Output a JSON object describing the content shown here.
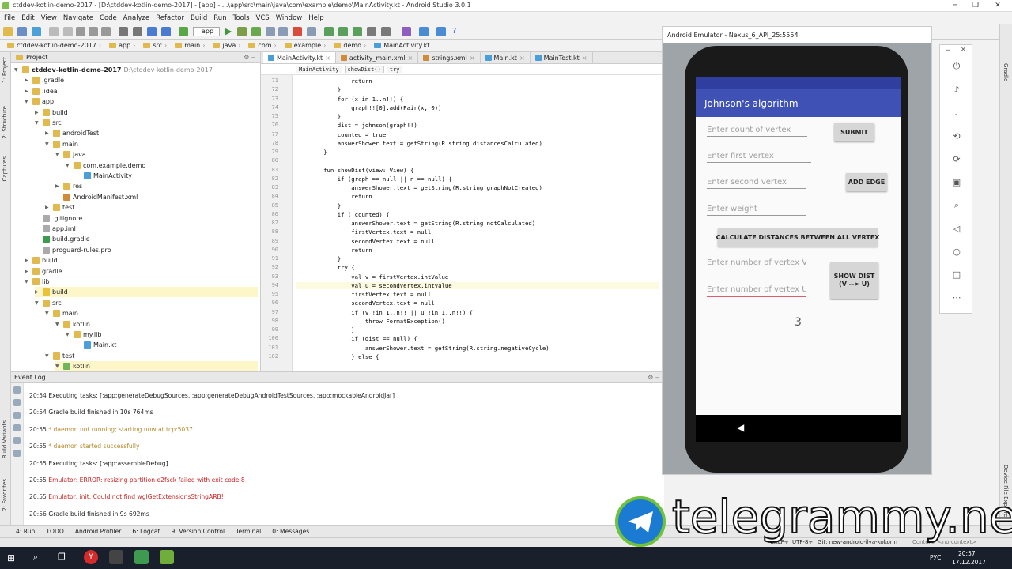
{
  "window": {
    "title": "ctddev-kotlin-demo-2017 - [D:\\ctddev-kotlin-demo-2017] - [app] - ...\\app\\src\\main\\java\\com\\example\\demo\\MainActivity.kt - Android Studio 3.0.1"
  },
  "menu": [
    "File",
    "Edit",
    "View",
    "Navigate",
    "Code",
    "Analyze",
    "Refactor",
    "Build",
    "Run",
    "Tools",
    "VCS",
    "Window",
    "Help"
  ],
  "toolbar": {
    "run_config": "app"
  },
  "breadcrumb": [
    "ctddev-kotlin-demo-2017",
    "app",
    "src",
    "main",
    "java",
    "com",
    "example",
    "demo",
    "MainActivity.kt"
  ],
  "project": {
    "header": "Project",
    "items": [
      {
        "label": "ctddev-kotlin-demo-2017",
        "extra": "D:\\ctddev-kotlin-demo-2017",
        "depth": 0,
        "open": true,
        "kind": "root"
      },
      {
        "label": ".gradle",
        "depth": 1,
        "open": false,
        "kind": "folder"
      },
      {
        "label": ".idea",
        "depth": 1,
        "open": false,
        "kind": "folder"
      },
      {
        "label": "app",
        "depth": 1,
        "open": true,
        "kind": "folder"
      },
      {
        "label": "build",
        "depth": 2,
        "open": false,
        "kind": "folder"
      },
      {
        "label": "src",
        "depth": 2,
        "open": true,
        "kind": "folder"
      },
      {
        "label": "androidTest",
        "depth": 3,
        "open": false,
        "kind": "folder"
      },
      {
        "label": "main",
        "depth": 3,
        "open": true,
        "kind": "folder"
      },
      {
        "label": "java",
        "depth": 4,
        "open": true,
        "kind": "folder"
      },
      {
        "label": "com.example.demo",
        "depth": 5,
        "open": true,
        "kind": "folder"
      },
      {
        "label": "MainActivity",
        "depth": 6,
        "open": null,
        "kind": "kotlin"
      },
      {
        "label": "res",
        "depth": 4,
        "open": false,
        "kind": "folder"
      },
      {
        "label": "AndroidManifest.xml",
        "depth": 4,
        "open": null,
        "kind": "xml"
      },
      {
        "label": "test",
        "depth": 3,
        "open": false,
        "kind": "folder"
      },
      {
        "label": ".gitignore",
        "depth": 2,
        "open": null,
        "kind": "file"
      },
      {
        "label": "app.iml",
        "depth": 2,
        "open": null,
        "kind": "file"
      },
      {
        "label": "build.gradle",
        "depth": 2,
        "open": null,
        "kind": "gradle"
      },
      {
        "label": "proguard-rules.pro",
        "depth": 2,
        "open": null,
        "kind": "file"
      },
      {
        "label": "build",
        "depth": 1,
        "open": false,
        "kind": "folder"
      },
      {
        "label": "gradle",
        "depth": 1,
        "open": false,
        "kind": "folder"
      },
      {
        "label": "lib",
        "depth": 1,
        "open": true,
        "kind": "folder"
      },
      {
        "label": "build",
        "depth": 2,
        "open": false,
        "kind": "folder-yellow"
      },
      {
        "label": "src",
        "depth": 2,
        "open": true,
        "kind": "folder"
      },
      {
        "label": "main",
        "depth": 3,
        "open": true,
        "kind": "folder"
      },
      {
        "label": "kotlin",
        "depth": 4,
        "open": true,
        "kind": "folder"
      },
      {
        "label": "my.lib",
        "depth": 5,
        "open": true,
        "kind": "folder"
      },
      {
        "label": "Main.kt",
        "depth": 6,
        "open": null,
        "kind": "kotlin"
      },
      {
        "label": "test",
        "depth": 3,
        "open": true,
        "kind": "folder"
      },
      {
        "label": "kotlin",
        "depth": 4,
        "open": true,
        "kind": "folder-green"
      }
    ]
  },
  "tabs": [
    {
      "label": "MainActivity.kt",
      "active": true
    },
    {
      "label": "activity_main.xml",
      "active": false
    },
    {
      "label": "strings.xml",
      "active": false
    },
    {
      "label": "Main.kt",
      "active": false
    },
    {
      "label": "MainTest.kt",
      "active": false
    }
  ],
  "editor_breadcrumb": [
    "MainActivity",
    "showDist()",
    "try"
  ],
  "code": [
    {
      "n": "71",
      "t": "                return"
    },
    {
      "n": "72",
      "t": "            }"
    },
    {
      "n": "73",
      "t": "            for (x in 1..n!!) {"
    },
    {
      "n": "74",
      "t": "                graph!![0].add(Pair(x, 0))"
    },
    {
      "n": "75",
      "t": "            }"
    },
    {
      "n": "76",
      "t": "            dist = johnson(graph!!)"
    },
    {
      "n": "77",
      "t": "            counted = true"
    },
    {
      "n": "78",
      "t": "            answerShower.text = getString(R.string.distancesCalculated)"
    },
    {
      "n": "79",
      "t": "        }"
    },
    {
      "n": "80",
      "t": ""
    },
    {
      "n": "81",
      "t": "        fun showDist(view: View) {"
    },
    {
      "n": "82",
      "t": "            if (graph == null || n == null) {"
    },
    {
      "n": "83",
      "t": "                answerShower.text = getString(R.string.graphNotCreated)"
    },
    {
      "n": "84",
      "t": "                return"
    },
    {
      "n": "85",
      "t": "            }"
    },
    {
      "n": "86",
      "t": "            if (!counted) {"
    },
    {
      "n": "87",
      "t": "                answerShower.text = getString(R.string.notCalculated)"
    },
    {
      "n": "88",
      "t": "                firstVertex.text = null"
    },
    {
      "n": "89",
      "t": "                secondVertex.text = null"
    },
    {
      "n": "90",
      "t": "                return"
    },
    {
      "n": "91",
      "t": "            }"
    },
    {
      "n": "92",
      "t": "            try {"
    },
    {
      "n": "93",
      "t": "                val v = firstVertex.intValue"
    },
    {
      "n": "94",
      "t": "                val u = secondVertex.intValue"
    },
    {
      "n": "95",
      "t": "                firstVertex.text = null"
    },
    {
      "n": "96",
      "t": "                secondVertex.text = null"
    },
    {
      "n": "97",
      "t": "                if (v !in 1..n!! || u !in 1..n!!) {"
    },
    {
      "n": "98",
      "t": "                    throw FormatException()"
    },
    {
      "n": "99",
      "t": "                }"
    },
    {
      "n": "100",
      "t": "                if (dist == null) {"
    },
    {
      "n": "101",
      "t": "                    answerShower.text = getString(R.string.negativeCycle)"
    },
    {
      "n": "102",
      "t": "                } else {"
    }
  ],
  "event_log": {
    "header": "Event Log",
    "lines": [
      {
        "ts": "20:54",
        "msg": "Executing tasks: [:app:generateDebugSources, :app:generateDebugAndroidTestSources, :app:mockableAndroidJar]",
        "color": "#222222"
      },
      {
        "ts": "20:54",
        "msg": "Gradle build finished in 10s 764ms",
        "color": "#222222"
      },
      {
        "ts": "20:55",
        "msg": "* daemon not running; starting now at tcp:5037",
        "color": "#b58a2e"
      },
      {
        "ts": "20:55",
        "msg": "* daemon started successfully",
        "color": "#b58a2e"
      },
      {
        "ts": "20:55",
        "msg": "Executing tasks: [:app:assembleDebug]",
        "color": "#222222"
      },
      {
        "ts": "20:55",
        "msg": "Emulator: ERROR: resizing partition e2fsck failed with exit code 8",
        "color": "#cc1f1f"
      },
      {
        "ts": "20:55",
        "msg": "Emulator: init: Could not find wglGetExtensionsStringARB!",
        "color": "#cc1f1f"
      },
      {
        "ts": "20:56",
        "msg": "Gradle build finished in 9s 692ms",
        "color": "#222222"
      }
    ]
  },
  "left_strip": [
    "1: Project",
    "2: Structure",
    "Captures",
    "Build Variants",
    "2: Favorites"
  ],
  "right_strip": [
    "Gradle",
    "Device File Explorer"
  ],
  "bottom_tabs": [
    "4: Run",
    "TODO",
    "Android Profiler",
    "6: Logcat",
    "9: Version Control",
    "Terminal",
    "0: Messages"
  ],
  "status": {
    "crlf": "CRLF÷",
    "enc": "UTF-8÷",
    "git": "Git: new-android-ilya-kokorin",
    "context": "Context: <no context>"
  },
  "emulator": {
    "title": "Android Emulator - Nexus_6_API_25:5554",
    "app_title": "Johnson's algorithm",
    "hint_count": "Enter count of vertex",
    "btn_submit": "SUBMIT",
    "hint_first": "Enter first vertex",
    "hint_second": "Enter second vertex",
    "btn_add_edge": "ADD EDGE",
    "hint_weight": "Enter weight",
    "btn_calc": "CALCULATE DISTANCES BETWEEN ALL VERTEX",
    "hint_v": "Enter number of vertex V",
    "hint_u": "Enter number of vertex U",
    "btn_show_line1": "SHOW DIST",
    "btn_show_line2": "(V --> U)",
    "answer": "3"
  },
  "taskbar": {
    "lang": "РУС",
    "time": "20:57",
    "date": "17.12.2017"
  },
  "watermark": "telegrammy.net",
  "colors": {
    "accent": "#3f51b5",
    "accent_dark": "#303f9f",
    "error": "#cc1f1f",
    "warn": "#b58a2e"
  }
}
